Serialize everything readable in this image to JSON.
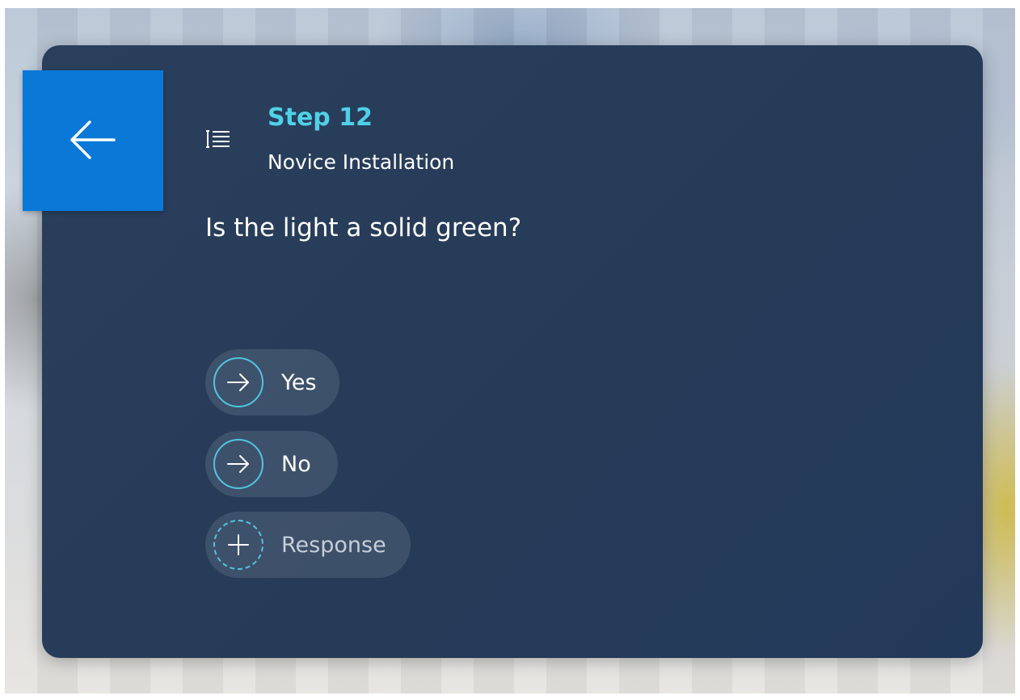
{
  "step": {
    "title": "Step 12",
    "subtitle": "Novice Installation",
    "question": "Is the light a solid green?"
  },
  "responses": [
    {
      "label": "Yes",
      "icon": "arrow-right-icon"
    },
    {
      "label": "No",
      "icon": "arrow-right-icon"
    }
  ],
  "add_response": {
    "label": "Response",
    "icon": "plus-icon"
  },
  "icons": {
    "back": "arrow-left-icon",
    "steps": "steps-list-icon"
  },
  "colors": {
    "accent": "#4fd1e8",
    "back_button": "#0a78d7",
    "card": "#263b58"
  }
}
